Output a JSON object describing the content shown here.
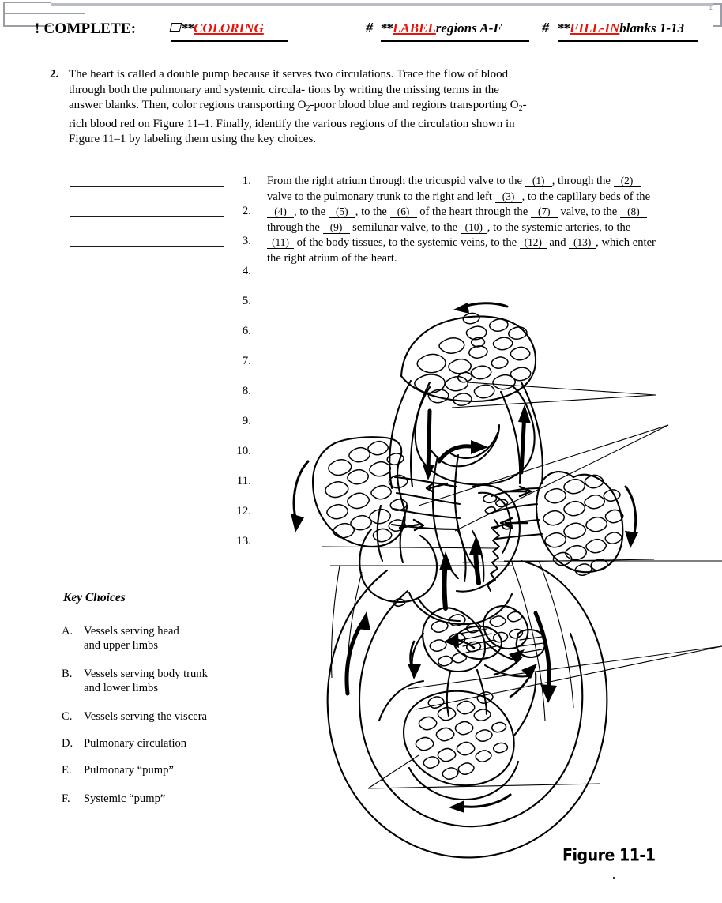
{
  "header": {
    "complete_label": "! COMPLETE:",
    "checkbox_icon": "skewed-box-icon",
    "task1_stars": "**",
    "task1_word": "COLORING",
    "sep1": "#",
    "task2_stars": "**",
    "task2_word": "LABEL",
    "task2_rest": "regions A-F",
    "sep2": "#",
    "task3_stars": "**",
    "task3_word": "FILL-IN",
    "task3_rest": "blanks 1-13",
    "red_color": "#e8140c"
  },
  "question": {
    "number": "2.",
    "line1": "The heart is called a double pump because it serves two circulations.",
    "line2": "Trace the flow of blood through both the pulmonary and systemic circula-",
    "line3": "tions by writing the missing terms in the answer blanks. Then, color",
    "line4a": "regions transporting O",
    "line4sub": "2",
    "line4b": "-poor blood blue and regions transporting O",
    "line4sub2": "2",
    "line4c": "-rich",
    "line5": "blood red on Figure 11–1. Finally, identify the various regions of the",
    "line6": "circulation shown in Figure 11–1 by labeling them using the key choices."
  },
  "answer_blanks": [
    {
      "number": "1.",
      "value": ""
    },
    {
      "number": "2.",
      "value": ""
    },
    {
      "number": "3.",
      "value": ""
    },
    {
      "number": "4.",
      "value": ""
    },
    {
      "number": "5.",
      "value": ""
    },
    {
      "number": "6.",
      "value": ""
    },
    {
      "number": "7.",
      "value": ""
    },
    {
      "number": "8.",
      "value": ""
    },
    {
      "number": "9.",
      "value": ""
    },
    {
      "number": "10.",
      "value": ""
    },
    {
      "number": "11.",
      "value": ""
    },
    {
      "number": "12.",
      "value": ""
    },
    {
      "number": "13.",
      "value": ""
    }
  ],
  "trace_paragraph": {
    "t0": "From the right atrium through the tricuspid valve to the ",
    "b1": "(1)",
    "t1": ", through the ",
    "b2": "(2)",
    "t2": " valve to the pulmonary trunk to the right and left ",
    "b3": "(3)",
    "t3": ", to the capillary beds of the ",
    "b4": "(4)",
    "t4": ", to the ",
    "b5": "(5)",
    "t5": ", to the ",
    "b6": "(6)",
    "t6": " of the heart through the ",
    "b7": "(7)",
    "t7": " valve, to the ",
    "b8": "(8)",
    "t8": " through the ",
    "b9": "(9)",
    "t9": " semilunar valve, to the ",
    "b10": "(10)",
    "t10": ", to the systemic arteries, to the ",
    "b11": "(11)",
    "t11": " of the body tissues, to the systemic veins, to the ",
    "b12": "(12)",
    "t12": " and ",
    "b13": "(13)",
    "t13": ", which enter the right atrium of the heart."
  },
  "key_choices": {
    "title": "Key Choices",
    "items": [
      {
        "letter": "A.",
        "line1": "Vessels serving head",
        "line2": "and upper limbs"
      },
      {
        "letter": "B.",
        "line1": "Vessels serving body trunk",
        "line2": "and lower limbs"
      },
      {
        "letter": "C.",
        "line1": "Vessels serving the viscera",
        "line2": ""
      },
      {
        "letter": "D.",
        "line1": "Pulmonary circulation",
        "line2": ""
      },
      {
        "letter": "E.",
        "line1": "Pulmonary “pump”",
        "line2": ""
      },
      {
        "letter": "F.",
        "line1": "Systemic “pump”",
        "line2": ""
      }
    ]
  },
  "figure": {
    "caption": "Figure 11-1",
    "description": "double-circulation-diagram",
    "label_leader_count": 6
  }
}
